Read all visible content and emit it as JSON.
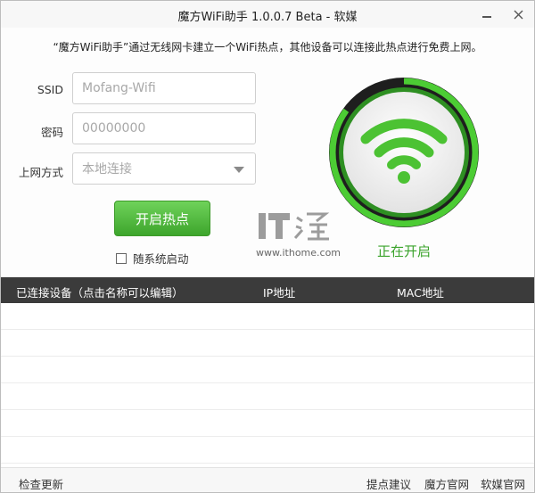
{
  "window": {
    "title": "魔方WiFi助手 1.0.0.7 Beta - 软媒",
    "minimize_icon": "minimize-icon",
    "close_icon": "close-icon"
  },
  "intro_text": "“魔方WiFi助手”通过无线网卡建立一个WiFi热点，其他设备可以连接此热点进行免费上网。",
  "form": {
    "ssid_label": "SSID",
    "ssid_value": "Mofang-Wifi",
    "password_label": "密码",
    "password_value": "00000000",
    "mode_label": "上网方式",
    "mode_value": "本地连接"
  },
  "start_button": "开启热点",
  "autostart_label": "随系统启动",
  "watermark": {
    "url": "www.ithome.com"
  },
  "status": {
    "text": "正在开启",
    "icon": "wifi-icon",
    "accent_color": "#3aa32b",
    "progress": 0.85
  },
  "table": {
    "headers": [
      "已连接设备（点击名称可以编辑）",
      "IP地址",
      "MAC地址"
    ],
    "rows": []
  },
  "footer": {
    "check_update": "检查更新",
    "feedback": "提点建议",
    "mofang_site": "魔方官网",
    "ruanmei_site": "软媒官网"
  }
}
